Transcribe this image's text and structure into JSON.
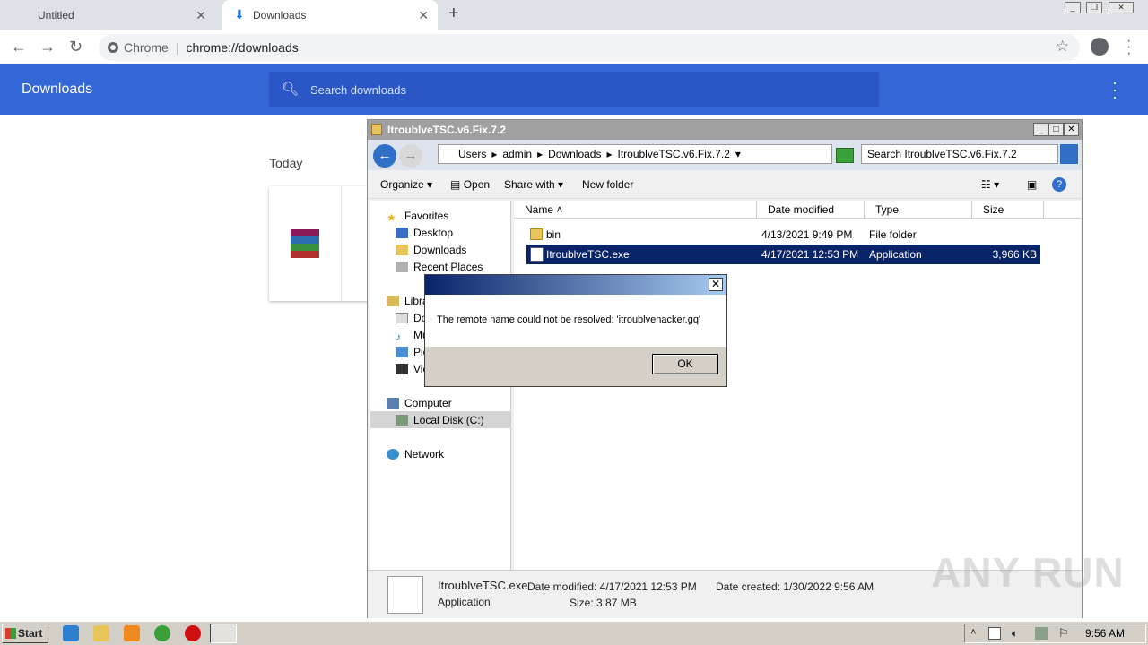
{
  "tabs": [
    {
      "label": "Untitled",
      "close": "✕"
    },
    {
      "label": "Downloads",
      "close": "✕"
    }
  ],
  "toolbar": {
    "site_label": "Chrome",
    "url": "chrome://downloads"
  },
  "downloads_page": {
    "title": "Downloads",
    "search_placeholder": "Search downloads",
    "section": "Today"
  },
  "explorer": {
    "title": "ItroublveTSC.v6.Fix.7.2",
    "breadcrumb": [
      "Users",
      "admin",
      "Downloads",
      "ItroublveTSC.v6.Fix.7.2"
    ],
    "search_placeholder": "Search ItroublveTSC.v6.Fix.7.2",
    "commands": {
      "organize": "Organize",
      "open": "Open",
      "share": "Share with",
      "new_folder": "New folder"
    },
    "nav": {
      "favorites": "Favorites",
      "desktop": "Desktop",
      "downloads": "Downloads",
      "recent": "Recent Places",
      "libraries": "Libra",
      "lib_documents": "Do",
      "lib_music": "Mu",
      "lib_pictures": "Pic",
      "lib_videos": "Vic",
      "computer": "Computer",
      "local_disk": "Local Disk (C:)",
      "network": "Network"
    },
    "columns": {
      "name": "Name",
      "date": "Date modified",
      "type": "Type",
      "size": "Size"
    },
    "files": [
      {
        "name": "bin",
        "date": "4/13/2021 9:49 PM",
        "type": "File folder",
        "size": ""
      },
      {
        "name": "ItroublveTSC.exe",
        "date": "4/17/2021 12:53 PM",
        "type": "Application",
        "size": "3,966 KB"
      }
    ],
    "details": {
      "name": "ItroublveTSC.exe",
      "kind": "Application",
      "modified": "Date modified: 4/17/2021 12:53 PM",
      "created": "Date created: 1/30/2022 9:56 AM",
      "size": "Size: 3.87 MB"
    }
  },
  "dialog": {
    "message": "The remote name could not be resolved: 'itroublvehacker.gq'",
    "ok_label": "OK",
    "close": "✕"
  },
  "taskbar": {
    "start_label": "Start",
    "clock": "9:56 AM"
  },
  "watermark": "ANY RUN",
  "colors": {
    "chrome_blue": "#3367d6",
    "selection": "#0a246a",
    "taskbar": "#d4d0c8"
  }
}
